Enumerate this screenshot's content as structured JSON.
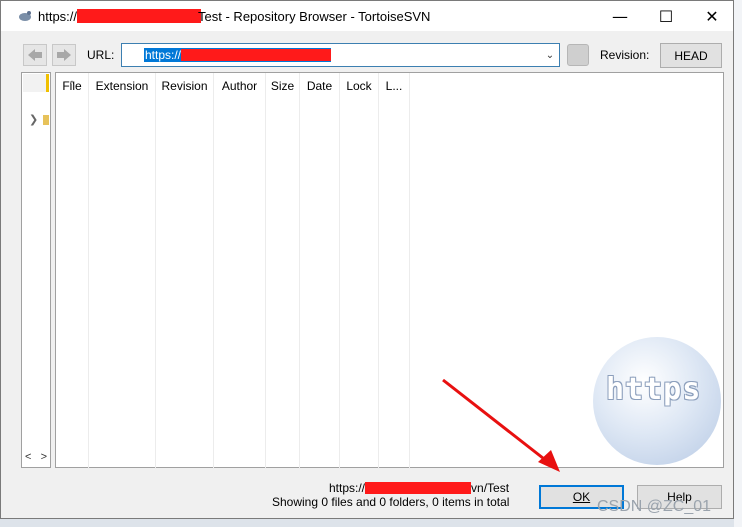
{
  "window": {
    "title_prefix": "https://",
    "title_suffix": "Test - Repository Browser - TortoiseSVN",
    "caption": {
      "minimize": "—",
      "maximize": "☐",
      "close": "✕"
    }
  },
  "toolbar": {
    "url_label": "URL:",
    "url_value": "https://",
    "revision_label": "Revision:",
    "revision_button": "HEAD"
  },
  "tree": {
    "scroll_left": "<",
    "scroll_right": ">"
  },
  "columns": [
    "File",
    "Extension",
    "Revision",
    "Author",
    "Size",
    "Date",
    "Lock",
    "L..."
  ],
  "status": {
    "url_prefix": "https://",
    "url_suffix": "vn/Test",
    "summary": "Showing 0 files and 0 folders, 0 items in total"
  },
  "buttons": {
    "ok": "OK",
    "help": "Help"
  },
  "overlay": {
    "globe_text": "https",
    "watermark": "CSDN @ZC_01"
  },
  "colors": {
    "accent": "#0078d7",
    "redaction": "#ff1a1a",
    "annotation_arrow": "#e81010"
  }
}
